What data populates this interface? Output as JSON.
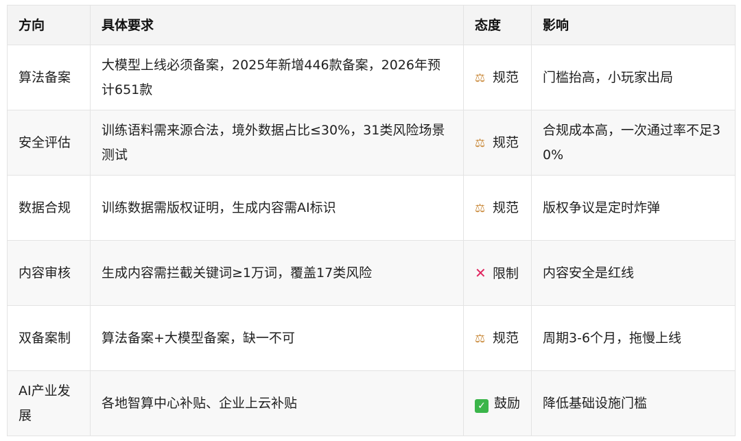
{
  "headers": [
    "方向",
    "具体要求",
    "态度",
    "影响"
  ],
  "rows": [
    {
      "direction": "算法备案",
      "requirement": "大模型上线必须备案，2025年新增446款备案，2026年预计651款",
      "attitude_icon": "balance-scale-icon",
      "attitude_glyph": "⚖",
      "attitude": "规范",
      "impact": "门槛抬高，小玩家出局"
    },
    {
      "direction": "安全评估",
      "requirement": "训练语料需来源合法，境外数据占比≤30%，31类风险场景测试",
      "attitude_icon": "balance-scale-icon",
      "attitude_glyph": "⚖",
      "attitude": "规范",
      "impact": "合规成本高，一次通过率不足30%"
    },
    {
      "direction": "数据合规",
      "requirement": "训练数据需版权证明，生成内容需AI标识",
      "attitude_icon": "balance-scale-icon",
      "attitude_glyph": "⚖",
      "attitude": "规范",
      "impact": "版权争议是定时炸弹"
    },
    {
      "direction": "内容审核",
      "requirement": "生成内容需拦截关键词≥1万词，覆盖17类风险",
      "attitude_icon": "cross-mark-icon",
      "attitude_glyph": "✕",
      "attitude": "限制",
      "impact": "内容安全是红线"
    },
    {
      "direction": "双备案制",
      "requirement": "算法备案+大模型备案，缺一不可",
      "attitude_icon": "balance-scale-icon",
      "attitude_glyph": "⚖",
      "attitude": "规范",
      "impact": "周期3-6个月，拖慢上线"
    },
    {
      "direction": "AI产业发展",
      "requirement": "各地智算中心补贴、企业上云补贴",
      "attitude_icon": "check-mark-icon",
      "attitude_glyph": "✓",
      "attitude": "鼓励",
      "impact": "降低基础设施门槛"
    }
  ],
  "colors": {
    "header_bg": "#f4f4f4",
    "border": "#e3e3e3",
    "scale": "#c9893a",
    "cross": "#e0245e",
    "check": "#3bb54a"
  }
}
